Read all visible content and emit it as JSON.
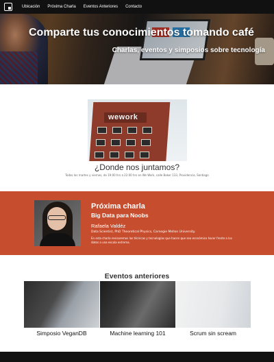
{
  "nav": {
    "logo_icon": "presentation-icon",
    "links": [
      "Ubicación",
      "Próxima Charla",
      "Eventos Anteriores",
      "Contacto"
    ]
  },
  "hero": {
    "title": "Comparte tus conocimientos tomando café",
    "subtitle": "Charlas, eventos y simposios sobre tecnología"
  },
  "location": {
    "sign_text": "wework",
    "title": "¿Donde nos juntamos?",
    "text": "Todos los martes y viernes, de 19:00 hrs a 22:00 hrs en We Work, calle Baker 133, Providencia, Santiago"
  },
  "next_talk": {
    "heading": "Próxima charla",
    "title": "Big Data para Noobs",
    "speaker": "Rafaela Valdéz",
    "role": "Data Scientist, PhD Theoretical Physics, Carnegie Mellon University.",
    "description": "En esta charla revisaremos las técnicas y tecnologías que hacen que sea económico hacer frente a los datos a una escala extrema.",
    "background_color": "#c64e2f"
  },
  "past_events": {
    "title": "Eventos anteriores",
    "items": [
      {
        "label": "Simposio VeganDB"
      },
      {
        "label": "Machine learning 101"
      },
      {
        "label": "Scrum sin scream"
      }
    ]
  }
}
